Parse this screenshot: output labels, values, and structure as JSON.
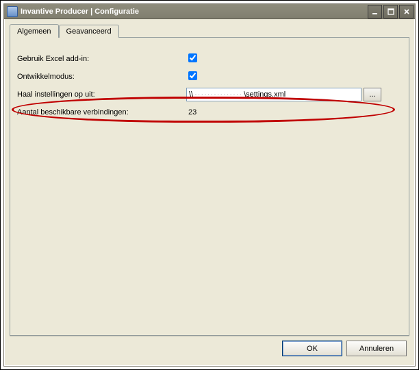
{
  "window": {
    "title": "Invantive Producer | Configuratie"
  },
  "tabs": {
    "general": "Algemeen",
    "advanced": "Geavanceerd"
  },
  "form": {
    "useExcelAddinLabel": "Gebruik Excel add-in:",
    "useExcelAddinChecked": true,
    "devModeLabel": "Ontwikkelmodus:",
    "devModeChecked": true,
    "settingsFromLabel": "Haal instellingen op uit:",
    "settingsPathPrefix": "\\\\",
    "settingsPathObscured": "···············",
    "settingsPathSuffix": "\\settings.xml",
    "browseLabel": "...",
    "connectionsLabel": "Aantal beschikbare verbindingen:",
    "connectionsValue": "23"
  },
  "buttons": {
    "ok": "OK",
    "cancel": "Annuleren"
  }
}
